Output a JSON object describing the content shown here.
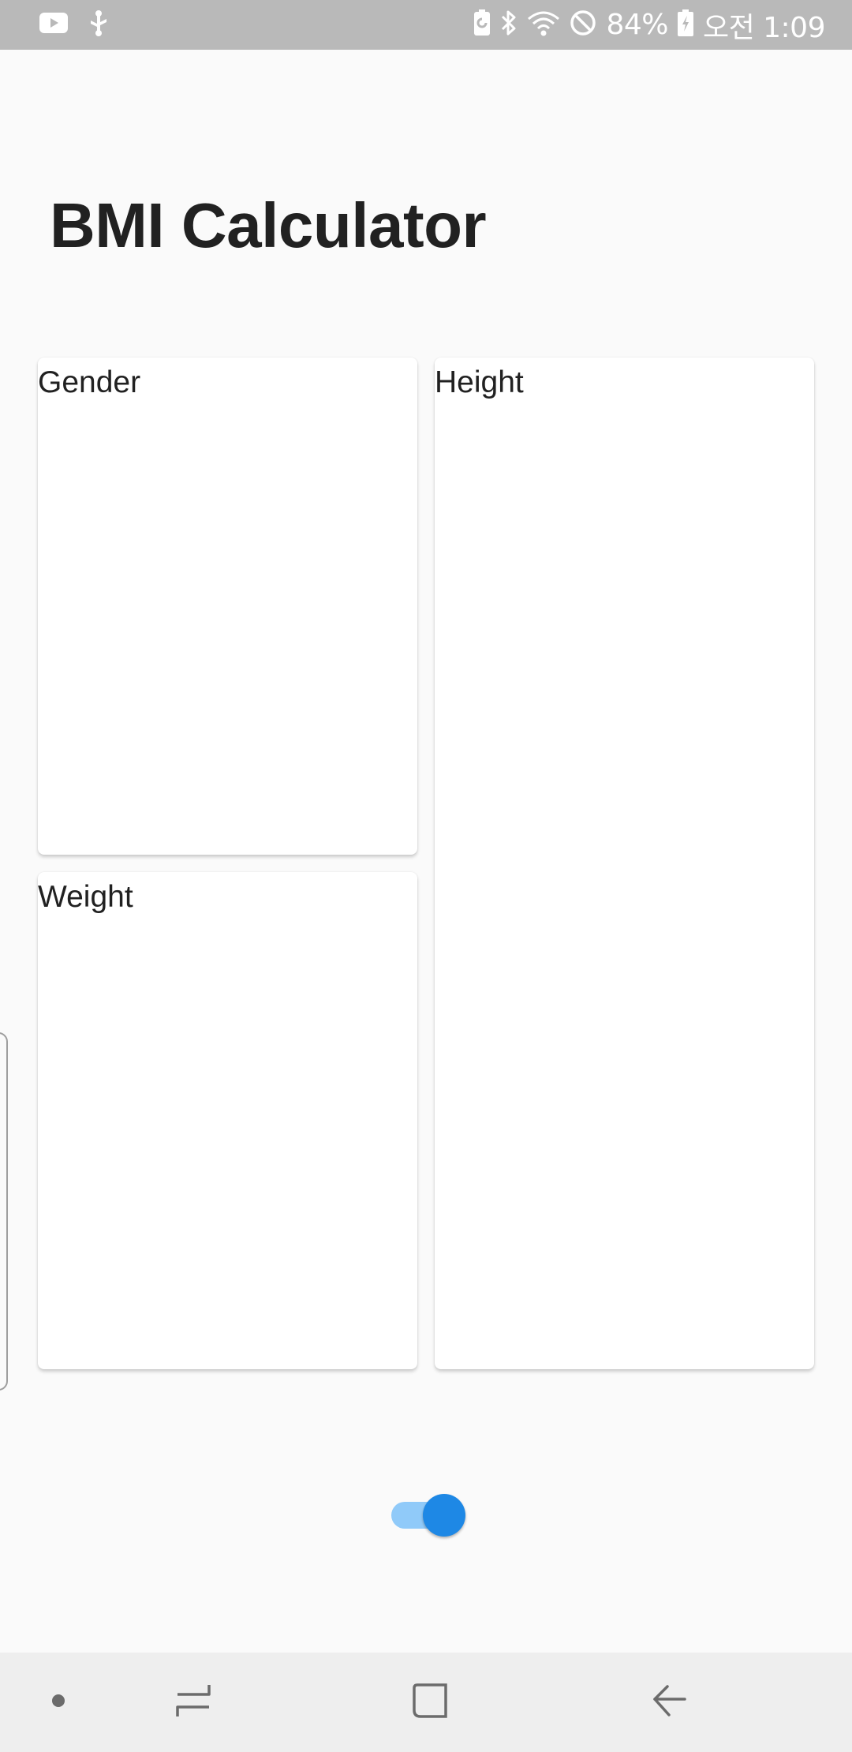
{
  "status_bar": {
    "battery_percent": "84%",
    "time": "오전 1:09",
    "left_icons": [
      "youtube-icon",
      "usb-debug-icon"
    ],
    "right_icons": [
      "battery-saver-icon",
      "bluetooth-icon",
      "wifi-icon",
      "do-not-disturb-icon",
      "charging-battery-icon"
    ]
  },
  "app": {
    "title": "BMI Calculator"
  },
  "cards": {
    "gender": {
      "label": "Gender"
    },
    "height": {
      "label": "Height"
    },
    "weight": {
      "label": "Weight"
    }
  },
  "toggle": {
    "checked": true,
    "track_color": "#90caf9",
    "thumb_color": "#1e88e5"
  },
  "nav_bar": {
    "buttons": [
      "dot-icon",
      "recents-icon",
      "home-icon",
      "back-icon"
    ]
  },
  "colors": {
    "background": "#fafafa",
    "status_bar": "#b9b9b9",
    "nav_bar": "#eeeeee",
    "text": "#212121"
  }
}
